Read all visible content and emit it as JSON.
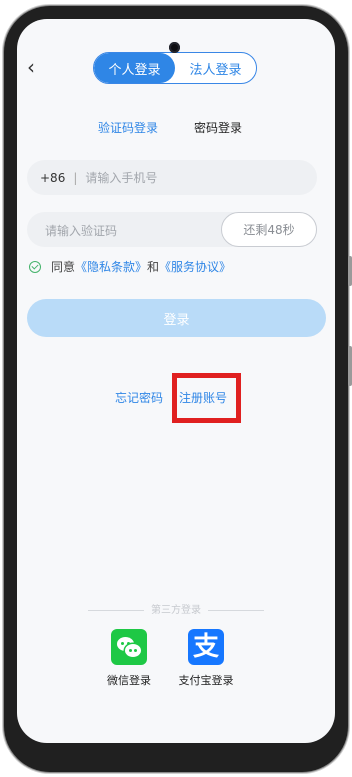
{
  "header": {
    "back_icon": "chevron-left-icon",
    "segments": [
      "个人登录",
      "法人登录"
    ],
    "active_segment": "个人登录"
  },
  "tabs": [
    "验证码登录",
    "密码登录"
  ],
  "active_tab": "验证码登录",
  "phone": {
    "country_code": "+86",
    "separator": "|",
    "placeholder": "请输入手机号"
  },
  "code": {
    "placeholder": "请输入验证码",
    "countdown": "还剩48秒"
  },
  "agreement": {
    "prefix": "同意",
    "privacy": "《隐私条款》",
    "and": "和",
    "service": "《服务协议》",
    "checked": true
  },
  "login_button": "登录",
  "links": {
    "forgot": "忘记密码",
    "register": "注册账号"
  },
  "third_party": {
    "title": "第三方登录",
    "wechat": "微信登录",
    "alipay": "支付宝登录",
    "alipay_glyph": "支"
  },
  "colors": {
    "accent": "#2f86e6",
    "highlight": "#e02020",
    "wechat": "#1ec845",
    "alipay": "#1677ff"
  }
}
